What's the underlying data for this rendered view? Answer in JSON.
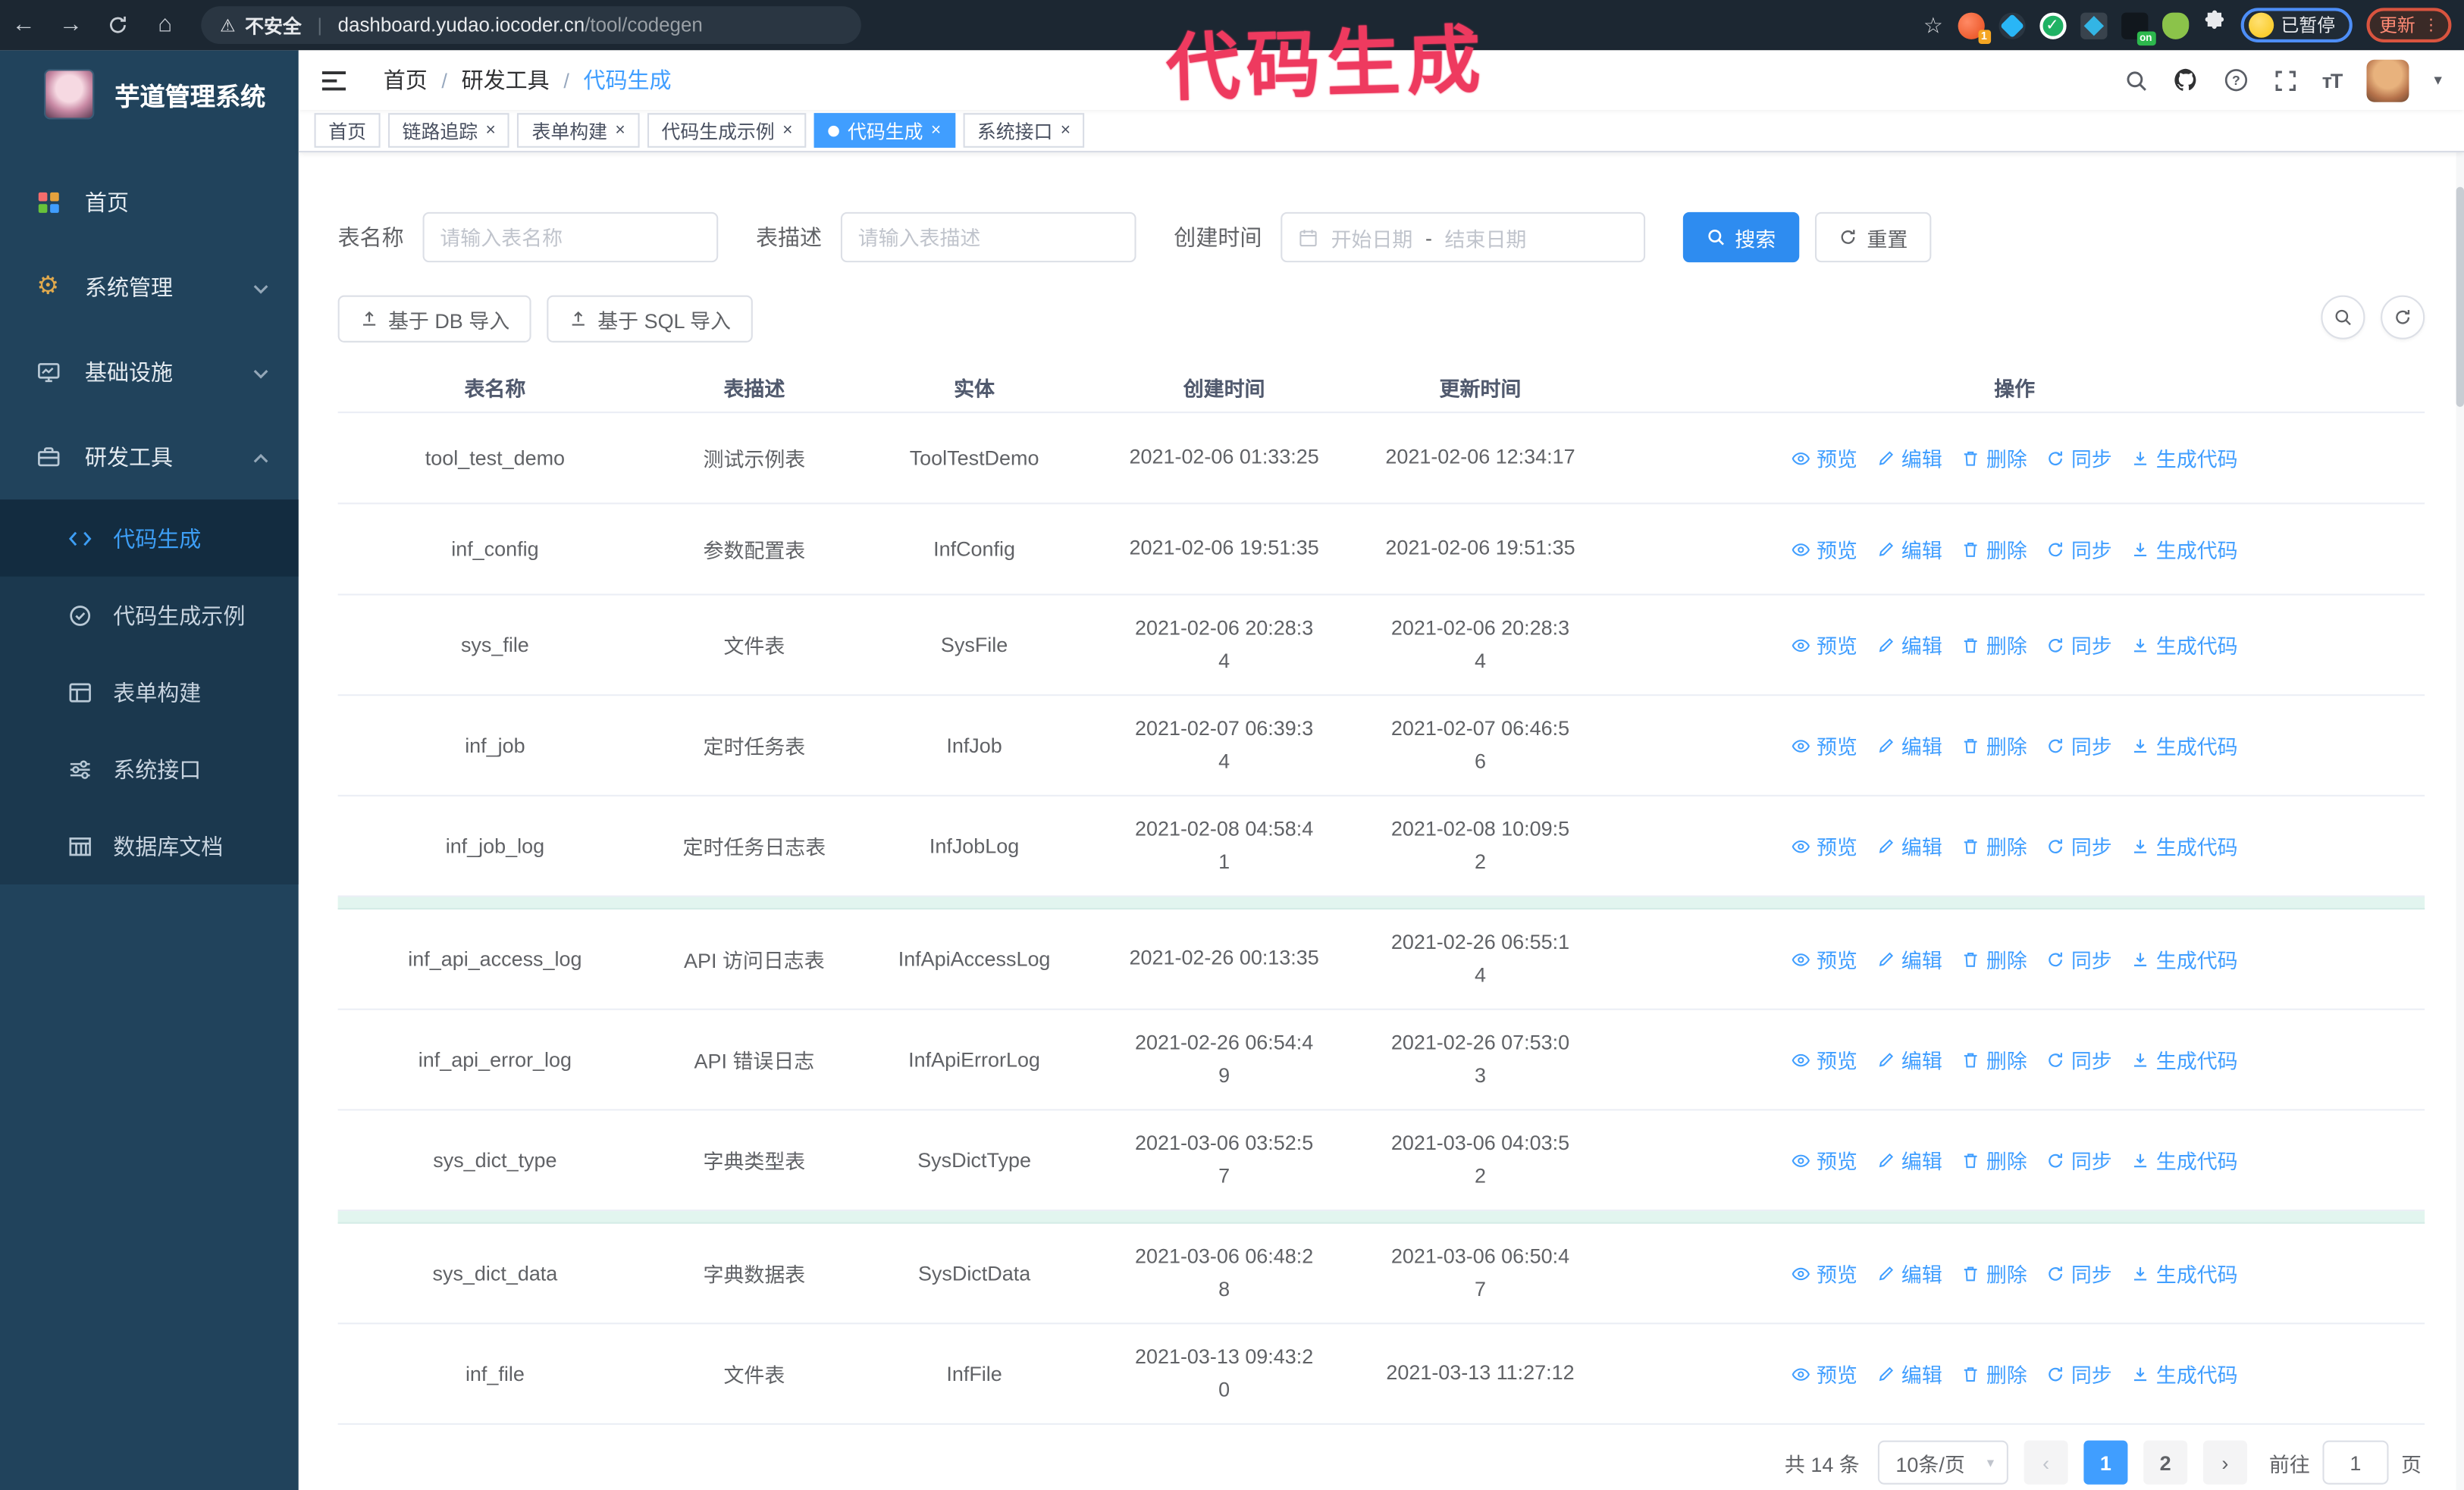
{
  "browser": {
    "secure_warning": "不安全",
    "url_host": "dashboard.yudao.iocoder.cn",
    "url_path": "/tool/codegen",
    "extension_badge": "1",
    "on_badge": "on",
    "profile_label": "已暂停",
    "update_label": "更新"
  },
  "annotation": "代码生成",
  "colors": {
    "accent": "#409eff",
    "annotation": "#ee3a5f",
    "sidebar_bg": "#21435c",
    "active_tab": "#409eff"
  },
  "sidebar": {
    "title": "芋道管理系统",
    "menu": [
      {
        "label": "首页",
        "icon": "dashboard-icon",
        "chevron": null
      },
      {
        "label": "系统管理",
        "icon": "gear-icon",
        "chevron": "down"
      },
      {
        "label": "基础设施",
        "icon": "monitor-icon",
        "chevron": "down"
      },
      {
        "label": "研发工具",
        "icon": "toolbox-icon",
        "chevron": "up"
      }
    ],
    "submenu": [
      {
        "label": "代码生成",
        "icon": "code-icon",
        "active": true
      },
      {
        "label": "代码生成示例",
        "icon": "badge-check-icon",
        "active": false
      },
      {
        "label": "表单构建",
        "icon": "form-icon",
        "active": false
      },
      {
        "label": "系统接口",
        "icon": "sliders-icon",
        "active": false
      },
      {
        "label": "数据库文档",
        "icon": "db-doc-icon",
        "active": false
      }
    ]
  },
  "header": {
    "breadcrumb": [
      "首页",
      "研发工具",
      "代码生成"
    ],
    "icons": [
      "search",
      "github",
      "help",
      "fullscreen",
      "font-size"
    ]
  },
  "tabs": [
    {
      "label": "首页",
      "closable": false,
      "active": false
    },
    {
      "label": "链路追踪",
      "closable": true,
      "active": false
    },
    {
      "label": "表单构建",
      "closable": true,
      "active": false
    },
    {
      "label": "代码生成示例",
      "closable": true,
      "active": false
    },
    {
      "label": "代码生成",
      "closable": true,
      "active": true
    },
    {
      "label": "系统接口",
      "closable": true,
      "active": false
    }
  ],
  "filters": {
    "name_label": "表名称",
    "name_placeholder": "请输入表名称",
    "desc_label": "表描述",
    "desc_placeholder": "请输入表描述",
    "time_label": "创建时间",
    "start_placeholder": "开始日期",
    "range_separator": "-",
    "end_placeholder": "结束日期",
    "search_label": "搜索",
    "reset_label": "重置"
  },
  "toolbar": {
    "import_db_label": "基于 DB 导入",
    "import_sql_label": "基于 SQL 导入"
  },
  "table": {
    "columns": [
      "表名称",
      "表描述",
      "实体",
      "创建时间",
      "更新时间",
      "操作"
    ],
    "actions": [
      "预览",
      "编辑",
      "删除",
      "同步",
      "生成代码"
    ],
    "action_icons": [
      "eye-icon",
      "edit-icon",
      "trash-icon",
      "sync-icon",
      "download-icon"
    ],
    "rows": [
      {
        "name": "tool_test_demo",
        "desc": "测试示例表",
        "entity": "ToolTestDemo",
        "created": "2021-02-06 01:33:25",
        "updated": "2021-02-06 12:34:17",
        "highlight_after": false
      },
      {
        "name": "inf_config",
        "desc": "参数配置表",
        "entity": "InfConfig",
        "created": "2021-02-06 19:51:35",
        "updated": "2021-02-06 19:51:35",
        "highlight_after": false
      },
      {
        "name": "sys_file",
        "desc": "文件表",
        "entity": "SysFile",
        "created": "2021-02-06 20:28:3\n4",
        "updated": "2021-02-06 20:28:3\n4",
        "highlight_after": false
      },
      {
        "name": "inf_job",
        "desc": "定时任务表",
        "entity": "InfJob",
        "created": "2021-02-07 06:39:3\n4",
        "updated": "2021-02-07 06:46:5\n6",
        "highlight_after": false
      },
      {
        "name": "inf_job_log",
        "desc": "定时任务日志表",
        "entity": "InfJobLog",
        "created": "2021-02-08 04:58:4\n1",
        "updated": "2021-02-08 10:09:5\n2",
        "highlight_after": true
      },
      {
        "name": "inf_api_access_log",
        "desc": "API 访问日志表",
        "entity": "InfApiAccessLog",
        "created": "2021-02-26 00:13:35",
        "updated": "2021-02-26 06:55:1\n4",
        "highlight_after": false
      },
      {
        "name": "inf_api_error_log",
        "desc": "API 错误日志",
        "entity": "InfApiErrorLog",
        "created": "2021-02-26 06:54:4\n9",
        "updated": "2021-02-26 07:53:0\n3",
        "highlight_after": false
      },
      {
        "name": "sys_dict_type",
        "desc": "字典类型表",
        "entity": "SysDictType",
        "created": "2021-03-06 03:52:5\n7",
        "updated": "2021-03-06 04:03:5\n2",
        "highlight_after": true
      },
      {
        "name": "sys_dict_data",
        "desc": "字典数据表",
        "entity": "SysDictData",
        "created": "2021-03-06 06:48:2\n8",
        "updated": "2021-03-06 06:50:4\n7",
        "highlight_after": false
      },
      {
        "name": "inf_file",
        "desc": "文件表",
        "entity": "InfFile",
        "created": "2021-03-13 09:43:2\n0",
        "updated": "2021-03-13 11:27:12",
        "highlight_after": false
      }
    ]
  },
  "pagination": {
    "total_text": "共 14 条",
    "page_size": "10条/页",
    "pages": [
      "1",
      "2"
    ],
    "active_page": "1",
    "prev_enabled": false,
    "next_enabled": true,
    "goto_label": "前往",
    "goto_value": "1",
    "goto_suffix": "页"
  }
}
